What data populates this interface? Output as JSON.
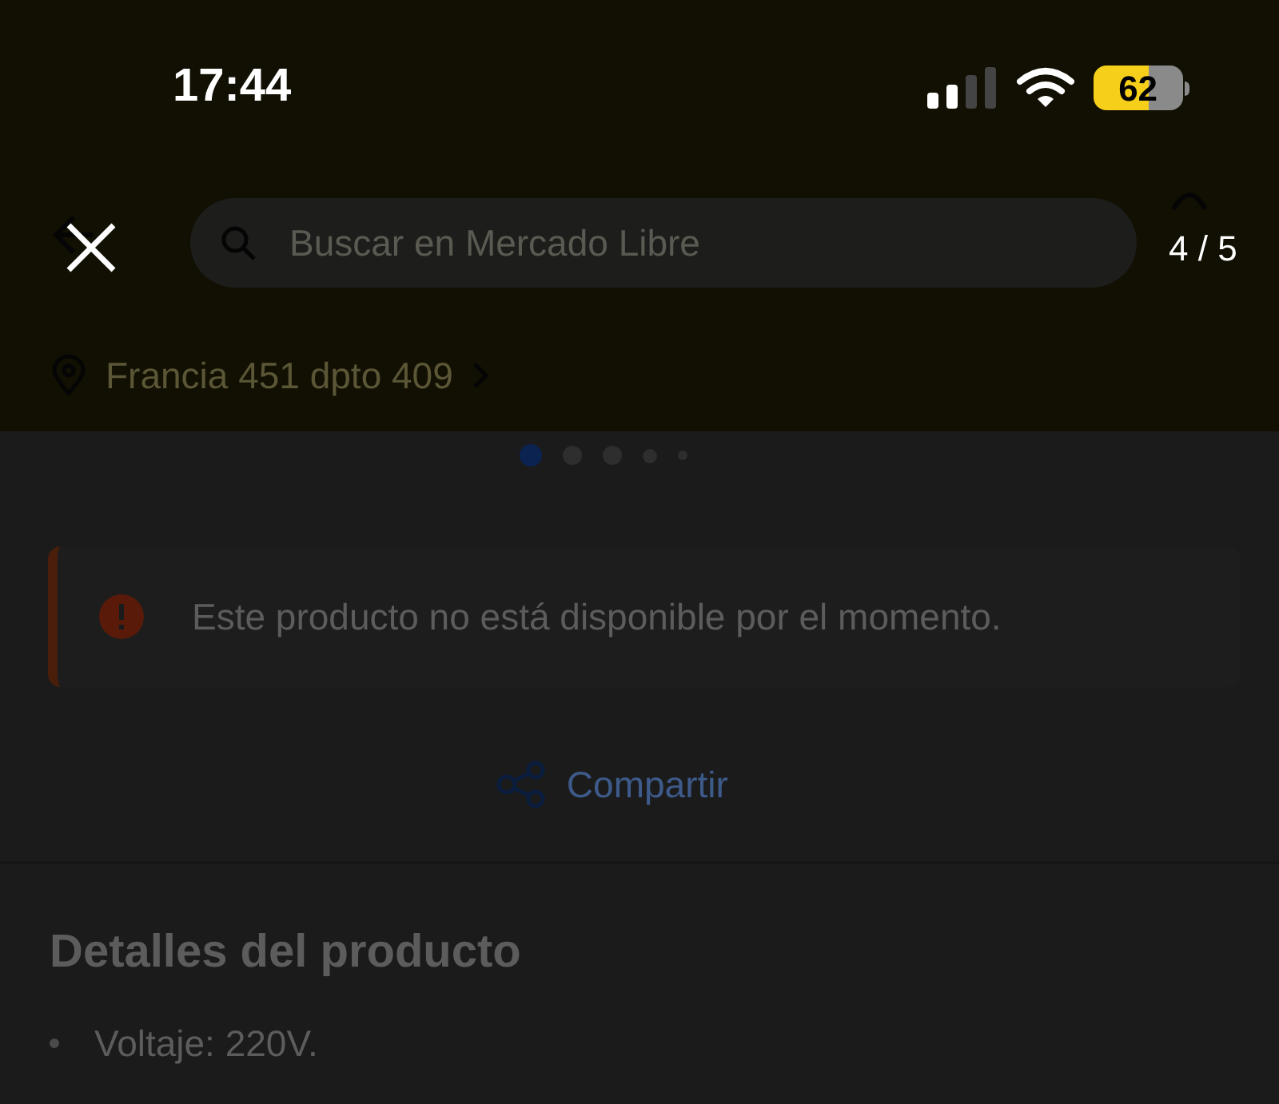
{
  "status_bar": {
    "time": "17:44",
    "battery": "62"
  },
  "viewer": {
    "counter": "4 / 5"
  },
  "header": {
    "search": {
      "placeholder": "Buscar en Mercado Libre"
    },
    "address": "Francia 451 dpto 409"
  },
  "carousel": {
    "dots": [
      {
        "selected": true
      },
      {
        "selected": false
      },
      {
        "selected": false
      },
      {
        "selected": false
      },
      {
        "selected": false
      }
    ]
  },
  "alert": {
    "text": "Este producto no está disponible por el momento."
  },
  "share": {
    "label": "Compartir"
  },
  "details": {
    "title": "Detalles del producto",
    "items": [
      "Voltaje: 220V."
    ]
  }
}
